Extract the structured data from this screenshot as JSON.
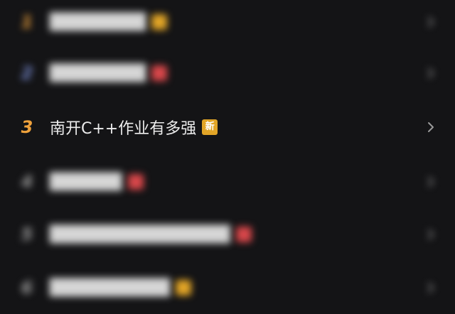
{
  "colors": {
    "background": "#141416",
    "rank_top": "#f0a23c",
    "badge_new": "#e2a527",
    "badge_hot": "#d8474a"
  },
  "hot_list": {
    "items": [
      {
        "rank": "",
        "title": "",
        "badge": "",
        "badge_color": "gold",
        "blurred": true
      },
      {
        "rank": "",
        "title": "",
        "badge": "",
        "badge_color": "red",
        "blurred": true
      },
      {
        "rank": "3",
        "title": "南开C++作业有多强",
        "badge": "新",
        "badge_color": "gold",
        "blurred": false
      },
      {
        "rank": "",
        "title": "",
        "badge": "",
        "badge_color": "red",
        "blurred": true
      },
      {
        "rank": "",
        "title": "",
        "badge": "",
        "badge_color": "red",
        "blurred": true
      },
      {
        "rank": "",
        "title": "",
        "badge": "",
        "badge_color": "gold",
        "blurred": true
      }
    ]
  }
}
